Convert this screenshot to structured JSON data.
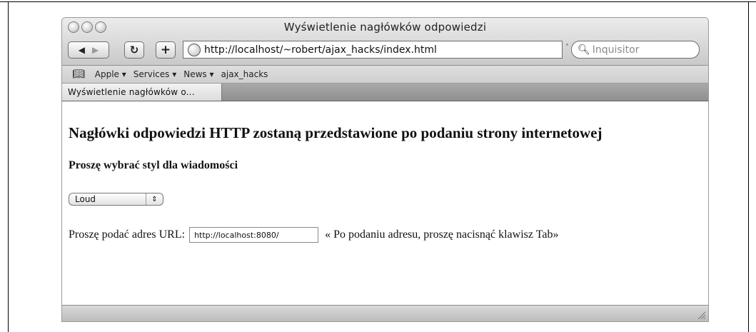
{
  "window": {
    "title": "Wyświetlenie nagłówków odpowiedzi"
  },
  "toolbar": {
    "back_icon": "back-arrow",
    "forward_icon": "forward-arrow",
    "reload_icon": "reload",
    "add_icon": "plus",
    "url": "http://localhost/~robert/ajax_hacks/index.html",
    "search_placeholder": "Inquisitor"
  },
  "bookmarks": {
    "book_icon": "book",
    "items": [
      {
        "label": "Apple ▾"
      },
      {
        "label": "Services ▾"
      },
      {
        "label": "News ▾"
      },
      {
        "label": "ajax_hacks"
      }
    ]
  },
  "tabs": [
    {
      "label": "Wyświetlenie nagłówków o..."
    }
  ],
  "page": {
    "heading": "Nagłówki odpowiedzi HTTP zostaną przedstawione po podaniu strony internetowej",
    "subheading": "Proszę wybrać styl dla wiadomości",
    "style_select_value": "Loud",
    "url_label": "Proszę podać adres URL:",
    "url_input_value": "http://localhost:8080/",
    "hint": "« Po podaniu adresu, proszę nacisnąć klawisz Tab»"
  }
}
